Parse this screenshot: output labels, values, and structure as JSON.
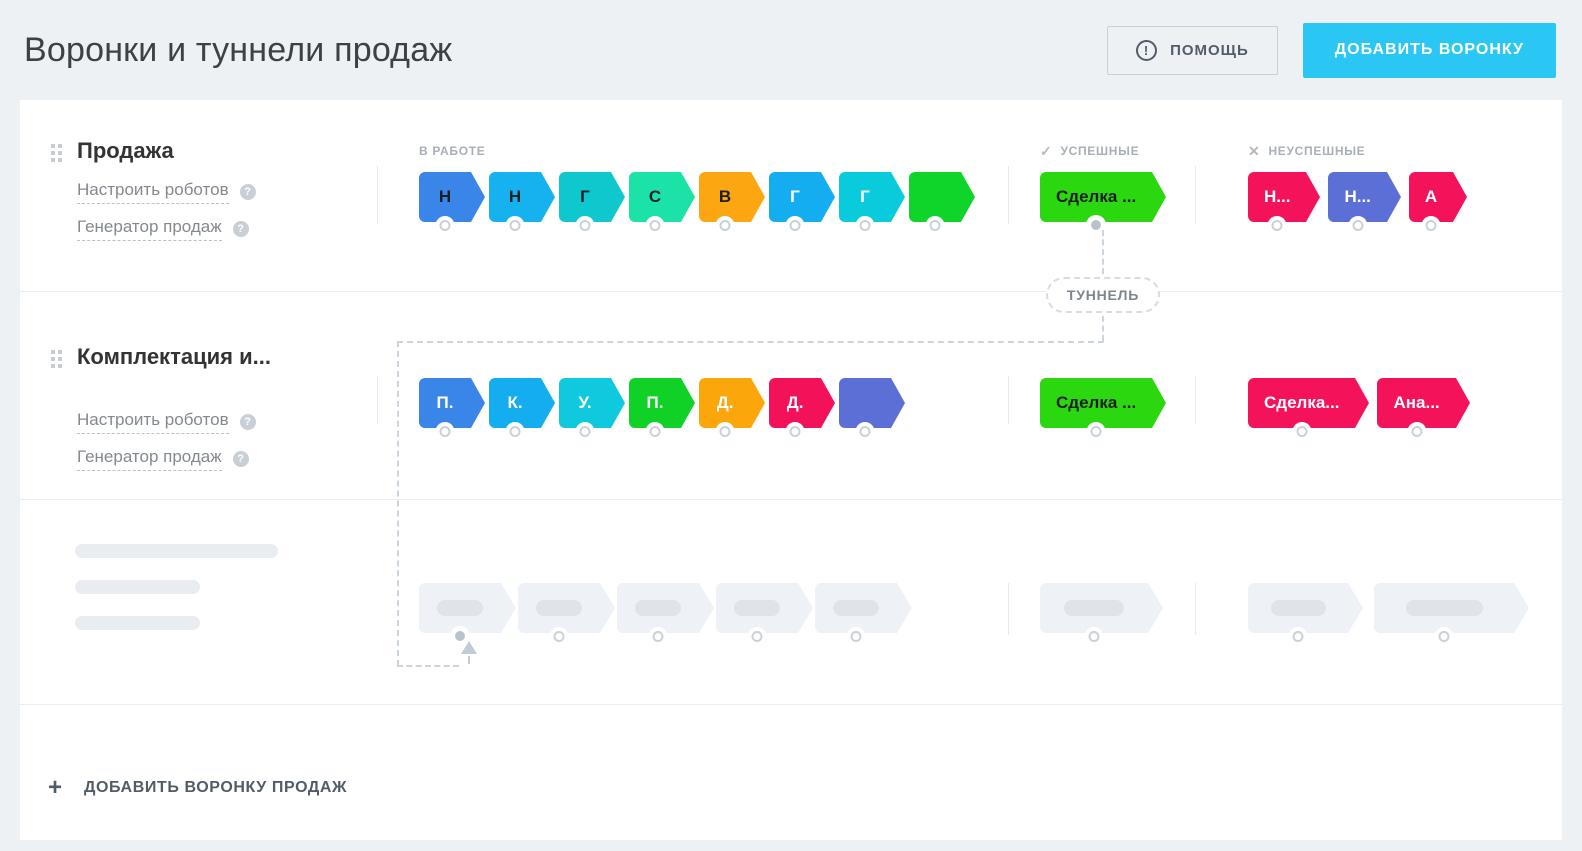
{
  "header": {
    "title": "Воронки и туннели продаж",
    "help_label": "ПОМОЩЬ",
    "add_funnel_label": "ДОБАВИТЬ ВОРОНКУ"
  },
  "sections": {
    "in_progress": "В РАБОТЕ",
    "success": "УСПЕШНЫЕ",
    "fail": "НЕУСПЕШНЫЕ"
  },
  "icons": {
    "success_mark": "✓",
    "fail_mark": "✕",
    "help_mark": "!",
    "question_mark": "?",
    "plus_mark": "+"
  },
  "tunnel": {
    "badge": "ТУННЕЛЬ"
  },
  "footer": {
    "add_funnel_label": "ДОБАВИТЬ ВОРОНКУ ПРОДАЖ"
  },
  "colors": {
    "accent_cyan": "#2BC7F4",
    "success_green": "#2BD70F",
    "fail_red": "#F4135B",
    "indigo": "#5B6FD6",
    "page_background": "#EDF1F4"
  },
  "funnels": [
    {
      "name": "Продажа",
      "links": [
        "Настроить роботов",
        "Генератор продаж"
      ],
      "stages": [
        {
          "label": "Н",
          "color": "#3A85E8",
          "text": "dark"
        },
        {
          "label": "Н",
          "color": "#16B1EF",
          "text": "dark"
        },
        {
          "label": "Г",
          "color": "#0FC8CE",
          "text": "dark"
        },
        {
          "label": "С",
          "color": "#1BE3A7",
          "text": "dark"
        },
        {
          "label": "В",
          "color": "#FCA712",
          "text": "dark"
        },
        {
          "label": "Г",
          "color": "#13ADF0",
          "text": "light"
        },
        {
          "label": "Г",
          "color": "#09CBDC",
          "text": "light"
        },
        {
          "label": "",
          "color": "#0FD52A",
          "text": "light"
        }
      ],
      "success_stages": [
        {
          "label": "Сделка ...",
          "color": "#2BD70F",
          "text": "dark",
          "connected": true
        }
      ],
      "fail_stages": [
        {
          "label": "Н...",
          "color": "#F4135B",
          "text": "light"
        },
        {
          "label": "Н...",
          "color": "#5B6FD6",
          "text": "light"
        },
        {
          "label": "А",
          "color": "#F4135B",
          "text": "light"
        }
      ]
    },
    {
      "name": "Комплектация и...",
      "links": [
        "Настроить роботов",
        "Генератор продаж"
      ],
      "stages": [
        {
          "label": "П.",
          "color": "#3A85E8",
          "text": "light"
        },
        {
          "label": "К.",
          "color": "#13ADF0",
          "text": "light"
        },
        {
          "label": "У.",
          "color": "#0FC9DE",
          "text": "light"
        },
        {
          "label": "П.",
          "color": "#10D125",
          "text": "light"
        },
        {
          "label": "Д.",
          "color": "#FBA70C",
          "text": "light"
        },
        {
          "label": "Д.",
          "color": "#F3125A",
          "text": "light"
        },
        {
          "label": "",
          "color": "#5B6FD6",
          "text": "light"
        }
      ],
      "success_stages": [
        {
          "label": "Сделка ...",
          "color": "#2BD70F",
          "text": "dark"
        }
      ],
      "fail_stages": [
        {
          "label": "Сделка...",
          "color": "#F4135B",
          "text": "light"
        },
        {
          "label": "Ана...",
          "color": "#F4135B",
          "text": "light"
        }
      ]
    }
  ],
  "skeleton": {
    "in_progress_count": 5,
    "success_count": 1,
    "fail_count": 2,
    "connected_chip_index": 0
  }
}
